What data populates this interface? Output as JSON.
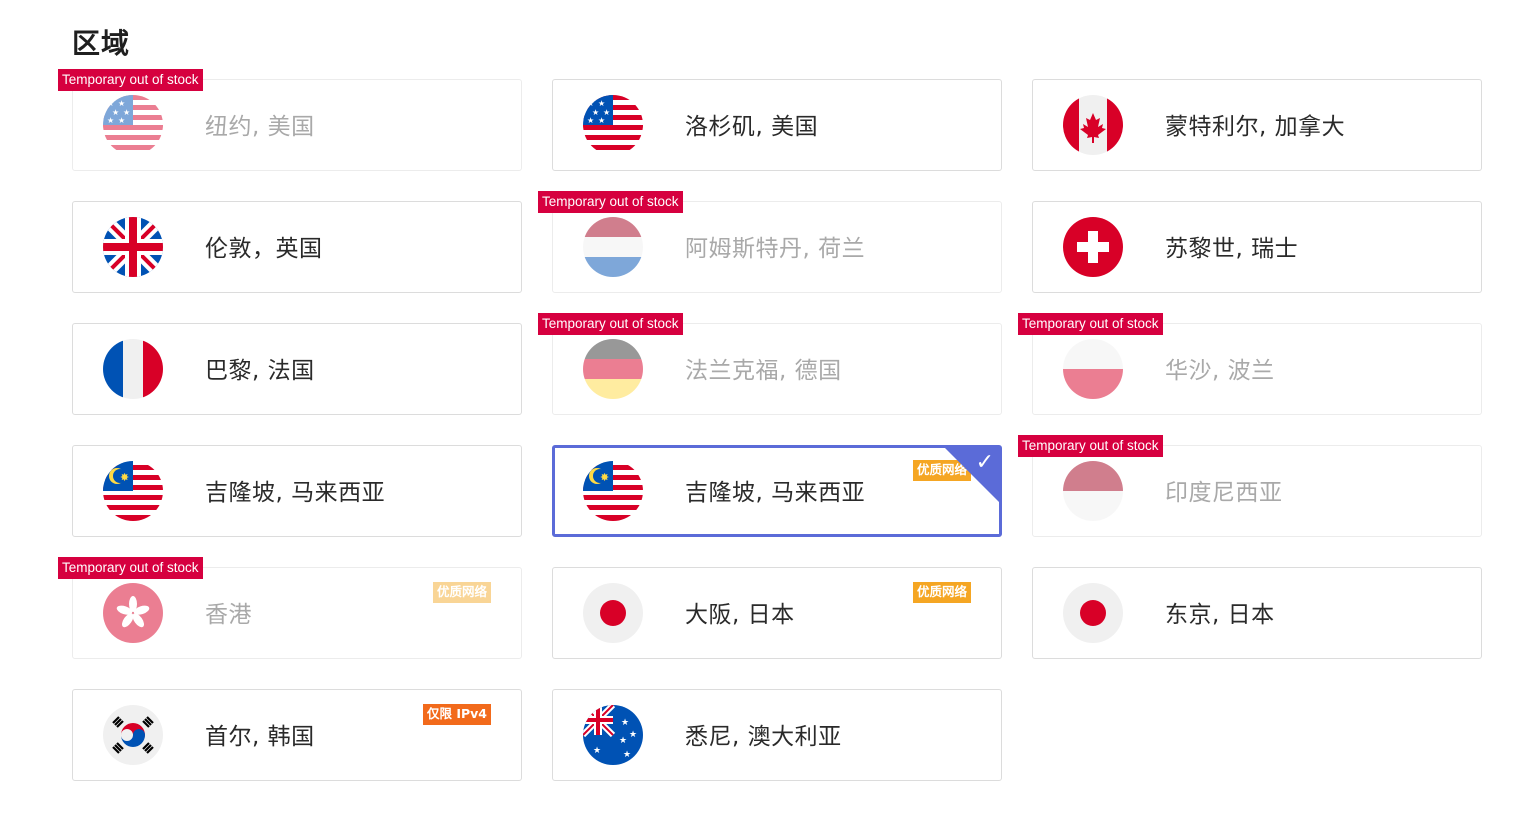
{
  "section": {
    "title": "区域"
  },
  "stock_label": "Temporary out of stock",
  "regions": [
    {
      "label": "纽约, 美国",
      "flag": "us-flag-icon",
      "out_of_stock": true
    },
    {
      "label": "洛杉矶, 美国",
      "flag": "us-flag-icon",
      "out_of_stock": false
    },
    {
      "label": "蒙特利尔, 加拿大",
      "flag": "canada-flag-icon",
      "out_of_stock": false
    },
    {
      "label": "伦敦，英国",
      "flag": "uk-flag-icon",
      "out_of_stock": false
    },
    {
      "label": "阿姆斯特丹, 荷兰",
      "flag": "netherlands-flag-icon",
      "out_of_stock": true
    },
    {
      "label": "苏黎世, 瑞士",
      "flag": "switzerland-flag-icon",
      "out_of_stock": false
    },
    {
      "label": "巴黎, 法国",
      "flag": "france-flag-icon",
      "out_of_stock": false
    },
    {
      "label": "法兰克福, 德国",
      "flag": "germany-flag-icon",
      "out_of_stock": true
    },
    {
      "label": "华沙, 波兰",
      "flag": "poland-flag-icon",
      "out_of_stock": true
    },
    {
      "label": "吉隆坡, 马来西亚",
      "flag": "malaysia-flag-icon",
      "out_of_stock": false
    },
    {
      "label": "吉隆坡, 马来西亚",
      "flag": "malaysia-flag-icon",
      "out_of_stock": false,
      "badge": "优质网络",
      "selected": true
    },
    {
      "label": "印度尼西亚",
      "flag": "indonesia-flag-icon",
      "out_of_stock": true
    },
    {
      "label": "香港",
      "flag": "hongkong-flag-icon",
      "out_of_stock": true,
      "badge": "优质网络"
    },
    {
      "label": "大阪, 日本",
      "flag": "japan-flag-icon",
      "out_of_stock": false,
      "badge": "优质网络"
    },
    {
      "label": "东京, 日本",
      "flag": "japan-flag-icon",
      "out_of_stock": false
    },
    {
      "label": "首尔, 韩国",
      "flag": "korea-flag-icon",
      "out_of_stock": false,
      "badge": "仅限 IPv4",
      "badge_type": "ipv4"
    },
    {
      "label": "悉尼, 澳大利亚",
      "flag": "australia-flag-icon",
      "out_of_stock": false
    }
  ],
  "colors": {
    "accent": "#5b6bd8",
    "stock_tag": "#d6003f",
    "badge_premium": "#f5a623",
    "badge_ipv4": "#f26a1b"
  }
}
